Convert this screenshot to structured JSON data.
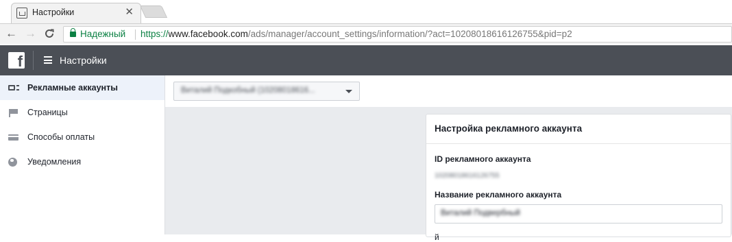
{
  "browser": {
    "tab_title": "Настройки",
    "tab_close": "✕",
    "nav_back": "←",
    "nav_forward": "→",
    "nav_reload": "C",
    "secure_label": "Надежный",
    "url_scheme": "https://",
    "url_host": "www.facebook.com",
    "url_path": "/ads/manager/account_settings/information/?act=10208018616126755&pid=p2"
  },
  "header": {
    "logo": "f",
    "title": "Настройки"
  },
  "sidebar": {
    "items": [
      {
        "label": "Рекламные аккаунты",
        "icon": "ad-accounts-icon",
        "active": true
      },
      {
        "label": "Страницы",
        "icon": "flag-icon",
        "active": false
      },
      {
        "label": "Способы оплаты",
        "icon": "credit-card-icon",
        "active": false
      },
      {
        "label": "Уведомления",
        "icon": "globe-icon",
        "active": false
      }
    ]
  },
  "main": {
    "account_selector": "Виталий Подкобный (10208018616...",
    "settings_card": {
      "title": "Настройка рекламного аккаунта",
      "id_label": "ID рекламного аккаунта",
      "id_value": "10208018616126755",
      "name_label": "Название рекламного аккаунта",
      "name_value": "Виталий Подвербный",
      "next_label": "й"
    }
  },
  "colors": {
    "fb_header": "#4b4f56",
    "secure_green": "#0b8043",
    "sidebar_active": "#edf2fa",
    "content_bg": "#e9ebee"
  }
}
